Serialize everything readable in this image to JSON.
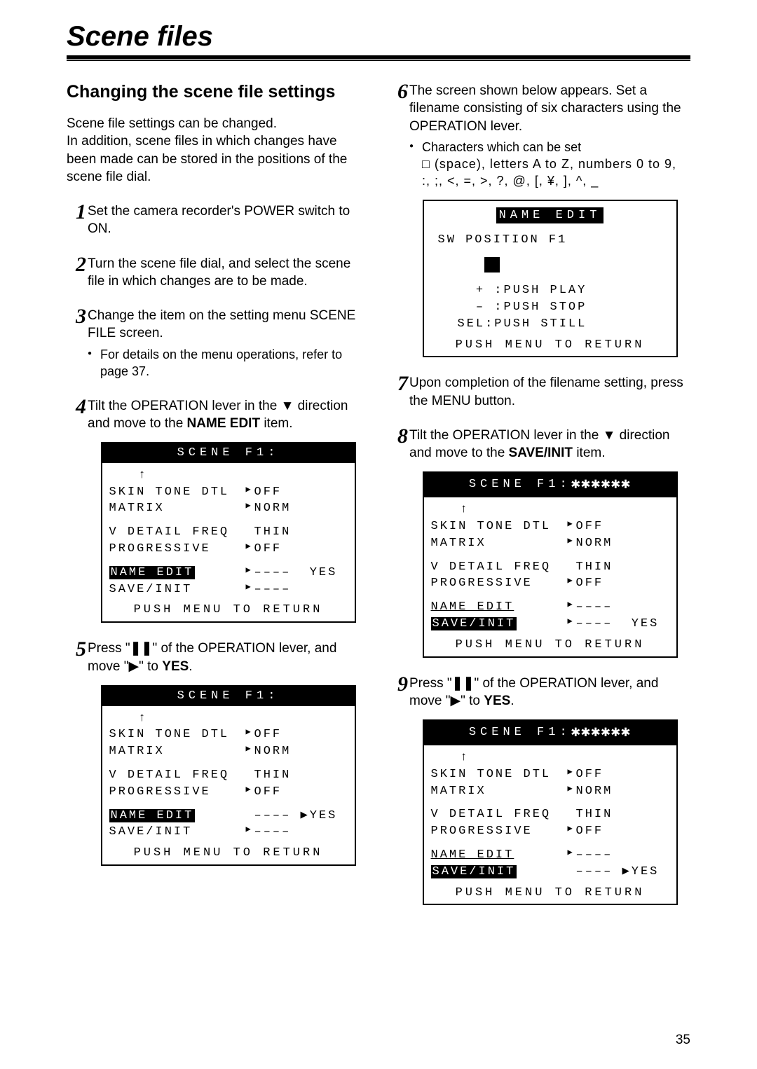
{
  "title": "Scene files",
  "subheading": "Changing the scene file settings",
  "intro": "Scene file settings can be changed.\nIn addition, scene files in which changes have been made can be stored in the positions of the scene file dial.",
  "steps": {
    "s1": "Set the camera recorder's POWER switch to ON.",
    "s2": "Turn the scene file dial, and select the scene file in which changes are to be made.",
    "s3": "Change the item on the setting menu SCENE FILE screen.",
    "s3b": "For details on the menu operations, refer to page 37.",
    "s4a": "Tilt the OPERATION lever in the ",
    "s4b": " direction and move to the ",
    "s4c": " item.",
    "s4bold": "NAME EDIT",
    "s5a": "Press \"",
    "s5b": "\" of the OPERATION lever, and move \"",
    "s5c": "\" to ",
    "s5yes": "YES",
    "s5d": ".",
    "s6": "The screen shown below appears. Set a filename consisting of six characters using the OPERATION lever.",
    "s6b": "Characters which can be set",
    "s6c1": "□ (space), letters A to Z, numbers 0 to 9,",
    "s6c2": ":, ;, <, =, >, ?, @, [, ¥, ], ^, _",
    "s7": "Upon completion of the filename setting, press the MENU button.",
    "s8a": "Tilt the OPERATION lever in the ",
    "s8b": " direction and move to the ",
    "s8c": " item.",
    "s8bold": "SAVE/INIT",
    "s9a": "Press \"",
    "s9b": "\" of the OPERATION lever, and move \"",
    "s9c": "\" to ",
    "s9yes": "YES",
    "s9d": "."
  },
  "screenA": {
    "header": "SCENE F1:",
    "rows": [
      {
        "label": "SKIN TONE DTL",
        "mark": "▶",
        "val": "OFF"
      },
      {
        "label": "MATRIX",
        "mark": "▶",
        "val": "NORM"
      },
      {
        "label": "",
        "mark": "",
        "val": ""
      },
      {
        "label": "V DETAIL FREQ",
        "mark": "",
        "val": "THIN"
      },
      {
        "label": "PROGRESSIVE",
        "mark": "▶",
        "val": "OFF"
      }
    ],
    "editrow": {
      "label": "NAME EDIT",
      "val": "––––",
      "trail": "YES"
    },
    "saverow": {
      "label": "SAVE/INIT",
      "mark": "▶",
      "val": "––––"
    },
    "foot": "PUSH MENU TO RETURN"
  },
  "screenB": {
    "header": "SCENE F1:",
    "editrow": {
      "label": "NAME EDIT",
      "val": "––––",
      "trail": "YES"
    },
    "saverow": {
      "label": "SAVE/INIT",
      "mark": "▶",
      "val": "––––"
    }
  },
  "screenNE": {
    "header": "NAME EDIT",
    "pos": "SW POSITION F1",
    "h1": "  + :PUSH PLAY",
    "h2": "  – :PUSH STOP",
    "h3": "SEL:PUSH STILL",
    "foot": "PUSH MENU TO RETURN"
  },
  "screenC": {
    "header": "SCENE F1:",
    "stars": "✱✱✱✱✱✱",
    "editrow": {
      "label": "NAME EDIT",
      "mark": "▶",
      "val": "––––"
    },
    "saverow": {
      "label": "SAVE/INIT",
      "mark": "▶",
      "val": "––––",
      "trail": "YES"
    }
  },
  "screenD": {
    "header": "SCENE F1:",
    "stars": "✱✱✱✱✱✱",
    "editrow": {
      "label": "NAME EDIT",
      "mark": "▶",
      "val": "––––"
    },
    "saverow": {
      "label": "SAVE/INIT",
      "val": "––––",
      "trail": "YES"
    }
  },
  "pageNum": "35"
}
